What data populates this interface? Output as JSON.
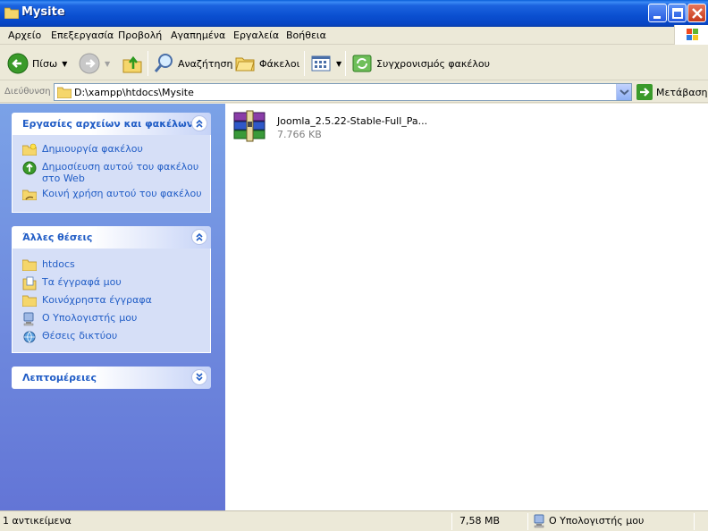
{
  "window": {
    "title": "Mysite"
  },
  "menu": [
    "Αρχείο",
    "Επεξεργασία",
    "Προβολή",
    "Αγαπημένα",
    "Εργαλεία",
    "Βοήθεια"
  ],
  "toolbar": {
    "back_label": "Πίσω",
    "search_label": "Αναζήτηση",
    "folders_label": "Φάκελοι",
    "sync_label": "Συγχρονισμός φακέλου"
  },
  "address": {
    "label": "Διεύθυνση",
    "path": "D:\\xampp\\htdocs\\Mysite",
    "go_label": "Μετάβαση"
  },
  "tasks_panel": {
    "title": "Εργασίες αρχείων και φακέλων",
    "items": [
      {
        "label": "Δημιουργία φακέλου",
        "icon": "new-folder-icon"
      },
      {
        "label": "Δημοσίευση αυτού του φακέλου",
        "label2": "στο Web",
        "icon": "publish-web-icon"
      },
      {
        "label": "Κοινή χρήση αυτού του φακέλου",
        "icon": "share-folder-icon"
      }
    ]
  },
  "places_panel": {
    "title": "Άλλες θέσεις",
    "items": [
      {
        "label": "htdocs",
        "icon": "folder-icon"
      },
      {
        "label": "Τα έγγραφά μου",
        "icon": "my-documents-icon"
      },
      {
        "label": "Κοινόχρηστα έγγραφα",
        "icon": "shared-documents-icon"
      },
      {
        "label": "Ο Υπολογιστής μου",
        "icon": "my-computer-icon"
      },
      {
        "label": "Θέσεις δικτύου",
        "icon": "network-places-icon"
      }
    ]
  },
  "details_panel": {
    "title": "Λεπτομέρειες"
  },
  "files": [
    {
      "name": "Joomla_2.5.22-Stable-Full_Pa...",
      "size": "7.766 KB",
      "icon": "winrar-archive-icon"
    }
  ],
  "status": {
    "count": "1 αντικείμενα",
    "size": "7,58 MB",
    "location": "Ο Υπολογιστής μου"
  },
  "colors": {
    "title_bar": "#0a4fd0",
    "left_pane_top": "#7ba2e7",
    "left_pane_bottom": "#6375d6",
    "link": "#215dc6"
  }
}
